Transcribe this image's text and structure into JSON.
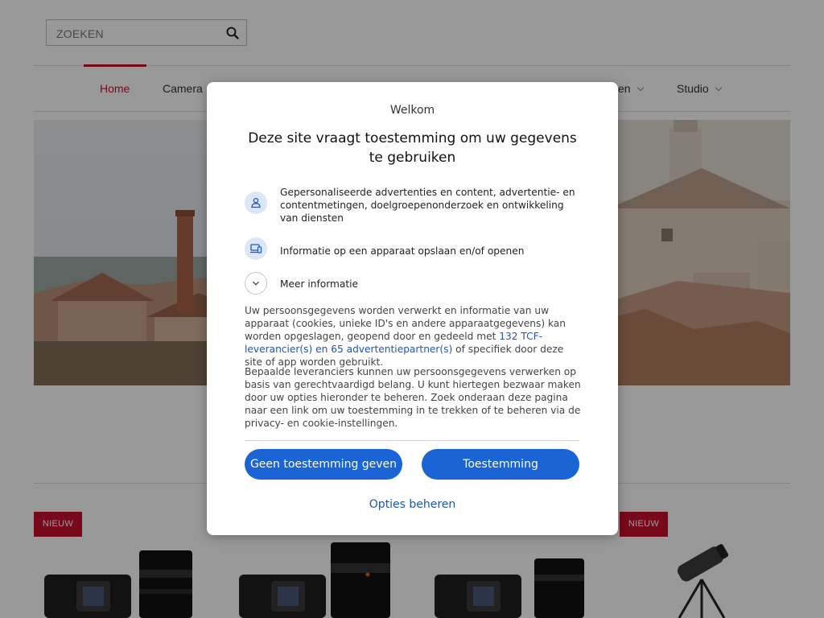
{
  "header": {
    "search_placeholder": "ZOEKEN",
    "nav": [
      {
        "label": "Home"
      },
      {
        "label": "Camera"
      },
      {
        "label": "en"
      },
      {
        "label": "Studio"
      }
    ]
  },
  "products": {
    "badges": [
      "NIEUW",
      "NIEUW"
    ]
  },
  "consent": {
    "welcome": "Welkom",
    "title": "Deze site vraagt toestemming om uw gegevens te gebruiken",
    "purposes": [
      {
        "icon": "person-icon",
        "text": "Gepersonaliseerde advertenties en content, advertentie- en contentmetingen, doelgroepenonderzoek en ontwikkeling van diensten"
      },
      {
        "icon": "devices-icon",
        "text": "Informatie op een apparaat opslaan en/of openen"
      }
    ],
    "more_info": "Meer informatie",
    "paragraph1_before": "Uw persoonsgegevens worden verwerkt en informatie van uw apparaat (cookies, unieke ID's en andere apparaatgegevens) kan worden opgeslagen, geopend door en gedeeld met ",
    "paragraph1_link": "132 TCF-leverancier(s) en 65 advertentiepartner(s)",
    "paragraph1_after": " of specifiek door deze site of app worden gebruikt.",
    "paragraph2": "Bepaalde leveranciers kunnen uw persoonsgegevens verwerken op basis van gerechtvaardigd belang. U kunt hiertegen bezwaar maken door uw opties hieronder te beheren. Zoek onderaan deze pagina naar een link om uw toestemming in te trekken of te beheren via de privacy- en cookie-instellingen.",
    "btn_decline": "Geen toestemming geven",
    "btn_accept": "Toestemming",
    "manage_options": "Opties beheren",
    "colors": {
      "primary": "#1a64d6",
      "link": "#1a56c4",
      "icon_bg": "#dbe6f7"
    }
  },
  "colors": {
    "brand_red": "#c8102e"
  }
}
